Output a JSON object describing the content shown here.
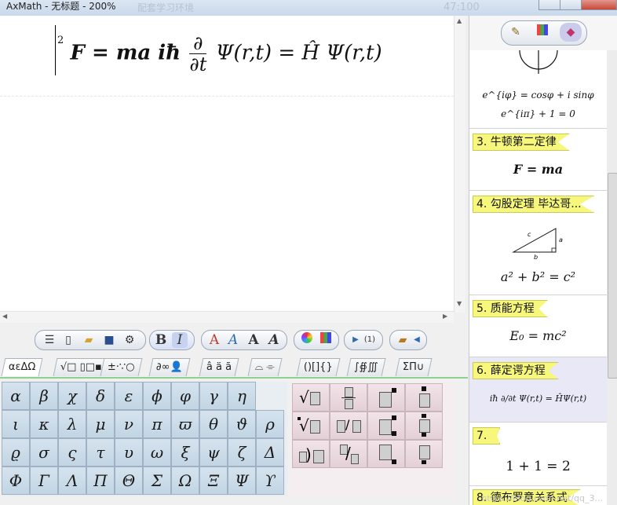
{
  "window": {
    "title": "AxMath - 无标题 - 200%",
    "ghost_left": "配套学习环境",
    "ghost_right": "47:100"
  },
  "editor": {
    "superscript": "2",
    "formula_left": "F = ma iħ",
    "frac_num": "∂",
    "frac_den": "∂t",
    "formula_right": "Ψ(r,t) = Ĥ Ψ(r,t)"
  },
  "toolbar": {
    "icons": [
      "menu-icon",
      "new-doc-icon",
      "open-folder-icon",
      "save-icon",
      "settings-icon",
      "bold-icon",
      "italic-icon",
      "text-color-a-icon",
      "text-style-a-icon",
      "text-bold-a-icon",
      "text-outline-a-icon",
      "color-wheel-icon",
      "palette-icon",
      "play-icon",
      "formula-number-icon",
      "export-icon"
    ],
    "bold_label": "B",
    "italic_label": "I",
    "a_labels": [
      "A",
      "A",
      "A",
      "A"
    ],
    "number_label": "(1)"
  },
  "tabs": [
    "αεΔΩ",
    "√□ ▯□▪",
    "±·∵○",
    "∂∞👤",
    "â ä ã",
    "⌓ ⌯",
    "()[]{}",
    "∫∯∭",
    "ΣΠ∪"
  ],
  "greek": [
    [
      "α",
      "β",
      "χ",
      "δ",
      "ε",
      "ϕ",
      "φ",
      "γ",
      "η"
    ],
    [
      "ι",
      "κ",
      "λ",
      "μ",
      "ν",
      "π",
      "ϖ",
      "θ",
      "ϑ",
      "ρ"
    ],
    [
      "ϱ",
      "σ",
      "ς",
      "τ",
      "υ",
      "ω",
      "ξ",
      "ψ",
      "ζ",
      "Δ"
    ],
    [
      "Φ",
      "Γ",
      "Λ",
      "Π",
      "Θ",
      "Σ",
      "Ω",
      "Ξ",
      "Ψ",
      "ϒ"
    ]
  ],
  "right_panel": {
    "tab_icons": [
      "paint-icon",
      "grid-icon",
      "bookmark-icon"
    ],
    "euler_1": "e^{iφ} = cosφ + i sinφ",
    "euler_2": "e^{iπ} + 1 = 0",
    "entries": [
      {
        "label": "3. 牛顿第二定律",
        "math": "F = ma"
      },
      {
        "label": "4. 勾股定理 毕达哥...",
        "math": "a² + b² = c²",
        "tri_a": "a",
        "tri_b": "b",
        "tri_c": "c"
      },
      {
        "label": "5. 质能方程",
        "math": "E₀ = mc²"
      },
      {
        "label": "6. 薛定谔方程",
        "math": "iħ ∂/∂t Ψ(r,t) = ĤΨ(r,t)"
      },
      {
        "label": "7.",
        "math": "1 + 1 = 2"
      },
      {
        "label": "8. 德布罗意关系式",
        "math": ""
      }
    ]
  },
  "watermark": "https://blog.csdn.net/qq_3..."
}
